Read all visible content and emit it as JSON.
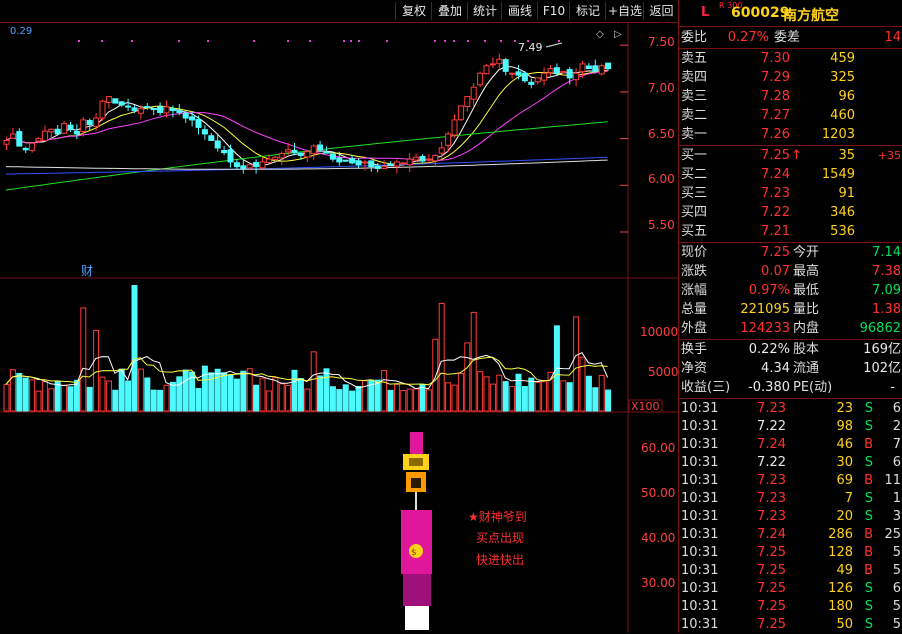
{
  "toolbar": {
    "items": [
      "复权",
      "叠加",
      "统计",
      "画线",
      "F10",
      "标记",
      "+自选",
      "返回"
    ]
  },
  "chart": {
    "indicator_value": "0.29",
    "price_axis": [
      "7.50",
      "7.00",
      "6.50",
      "6.00",
      "5.50"
    ],
    "high_marker": "7.49",
    "finance_marker": "财",
    "volume_axis": [
      "10000",
      "5000"
    ],
    "volume_unit": "X100",
    "lower_axis": [
      "60.00",
      "50.00",
      "40.00",
      "30.00"
    ],
    "signal_text": [
      "★财神爷到",
      "买点出现",
      "快进快出"
    ],
    "colors": {
      "up": "#ff3b3b",
      "down": "#4dfbff",
      "ma5": "#ffffff",
      "ma10": "#ffff40",
      "ma20": "#ff40ff",
      "ma60": "#20e020",
      "ma120": "#3050ff",
      "ma250": "#e0e0e0"
    }
  },
  "quote": {
    "prefix": "L",
    "tag": "R 300",
    "code": "600029",
    "name": "南方航空",
    "weibi_label": "委比",
    "weibi": "0.27%",
    "weicha_label": "委差",
    "weicha": "14",
    "asks": [
      {
        "label": "卖五",
        "price": "7.30",
        "vol": "459"
      },
      {
        "label": "卖四",
        "price": "7.29",
        "vol": "325"
      },
      {
        "label": "卖三",
        "price": "7.28",
        "vol": "96"
      },
      {
        "label": "卖二",
        "price": "7.27",
        "vol": "460"
      },
      {
        "label": "卖一",
        "price": "7.26",
        "vol": "1203"
      }
    ],
    "bids": [
      {
        "label": "买一",
        "price": "7.25",
        "vol": "35",
        "chg": "+35",
        "arrow": "↑"
      },
      {
        "label": "买二",
        "price": "7.24",
        "vol": "1549"
      },
      {
        "label": "买三",
        "price": "7.23",
        "vol": "91"
      },
      {
        "label": "买四",
        "price": "7.22",
        "vol": "346"
      },
      {
        "label": "买五",
        "price": "7.21",
        "vol": "536"
      }
    ],
    "stats": [
      {
        "l1": "现价",
        "v1": "7.25",
        "c1": "red",
        "l2": "今开",
        "v2": "7.14",
        "c2": "grn"
      },
      {
        "l1": "涨跌",
        "v1": "0.07",
        "c1": "red",
        "l2": "最高",
        "v2": "7.38",
        "c2": "red"
      },
      {
        "l1": "涨幅",
        "v1": "0.97%",
        "c1": "red",
        "l2": "最低",
        "v2": "7.09",
        "c2": "grn"
      },
      {
        "l1": "总量",
        "v1": "221095",
        "c1": "yel",
        "l2": "量比",
        "v2": "1.38",
        "c2": "red"
      },
      {
        "l1": "外盘",
        "v1": "124233",
        "c1": "red",
        "l2": "内盘",
        "v2": "96862",
        "c2": "grn"
      }
    ],
    "stats2": [
      {
        "l1": "换手",
        "v1": "0.22%",
        "l2": "股本",
        "v2": "169亿"
      },
      {
        "l1": "净资",
        "v1": "4.34",
        "l2": "流通",
        "v2": "102亿"
      },
      {
        "l1": "收益(三)",
        "v1": "-0.380",
        "l2": "PE(动)",
        "v2": "-"
      }
    ],
    "ticks": [
      {
        "time": "10:31",
        "price": "7.23",
        "vol": "23",
        "bs": "S",
        "n": "6"
      },
      {
        "time": "10:31",
        "price": "7.22",
        "vol": "98",
        "bs": "S",
        "n": "2"
      },
      {
        "time": "10:31",
        "price": "7.24",
        "vol": "46",
        "bs": "B",
        "n": "7"
      },
      {
        "time": "10:31",
        "price": "7.22",
        "vol": "30",
        "bs": "S",
        "n": "6"
      },
      {
        "time": "10:31",
        "price": "7.23",
        "vol": "69",
        "bs": "B",
        "n": "11"
      },
      {
        "time": "10:31",
        "price": "7.23",
        "vol": "7",
        "bs": "S",
        "n": "1"
      },
      {
        "time": "10:31",
        "price": "7.23",
        "vol": "20",
        "bs": "S",
        "n": "3"
      },
      {
        "time": "10:31",
        "price": "7.24",
        "vol": "286",
        "bs": "B",
        "n": "25"
      },
      {
        "time": "10:31",
        "price": "7.25",
        "vol": "128",
        "bs": "B",
        "n": "5"
      },
      {
        "time": "10:31",
        "price": "7.25",
        "vol": "49",
        "bs": "B",
        "n": "5"
      },
      {
        "time": "10:31",
        "price": "7.25",
        "vol": "126",
        "bs": "S",
        "n": "6"
      },
      {
        "time": "10:31",
        "price": "7.25",
        "vol": "180",
        "bs": "S",
        "n": "5"
      },
      {
        "time": "10:31",
        "price": "7.25",
        "vol": "50",
        "bs": "S",
        "n": "5"
      }
    ]
  }
}
